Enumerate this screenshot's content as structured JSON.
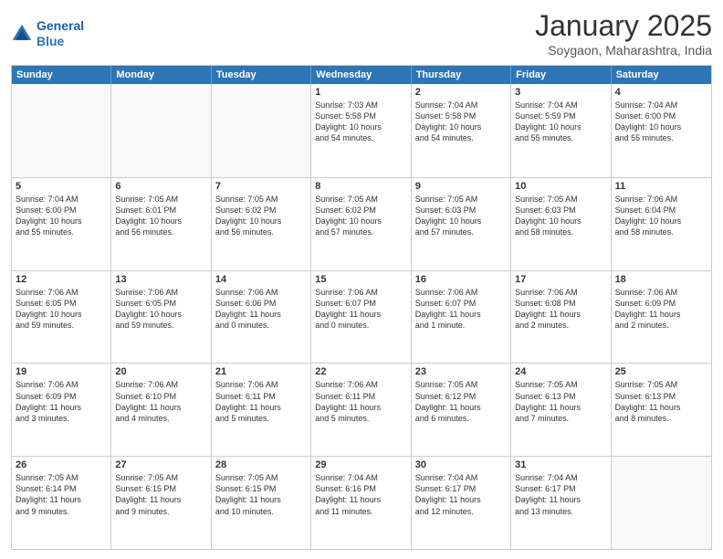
{
  "header": {
    "logo_line1": "General",
    "logo_line2": "Blue",
    "month": "January 2025",
    "location": "Soygaon, Maharashtra, India"
  },
  "weekdays": [
    "Sunday",
    "Monday",
    "Tuesday",
    "Wednesday",
    "Thursday",
    "Friday",
    "Saturday"
  ],
  "weeks": [
    [
      {
        "day": "",
        "info": ""
      },
      {
        "day": "",
        "info": ""
      },
      {
        "day": "",
        "info": ""
      },
      {
        "day": "1",
        "info": "Sunrise: 7:03 AM\nSunset: 5:58 PM\nDaylight: 10 hours\nand 54 minutes."
      },
      {
        "day": "2",
        "info": "Sunrise: 7:04 AM\nSunset: 5:58 PM\nDaylight: 10 hours\nand 54 minutes."
      },
      {
        "day": "3",
        "info": "Sunrise: 7:04 AM\nSunset: 5:59 PM\nDaylight: 10 hours\nand 55 minutes."
      },
      {
        "day": "4",
        "info": "Sunrise: 7:04 AM\nSunset: 6:00 PM\nDaylight: 10 hours\nand 55 minutes."
      }
    ],
    [
      {
        "day": "5",
        "info": "Sunrise: 7:04 AM\nSunset: 6:00 PM\nDaylight: 10 hours\nand 55 minutes."
      },
      {
        "day": "6",
        "info": "Sunrise: 7:05 AM\nSunset: 6:01 PM\nDaylight: 10 hours\nand 56 minutes."
      },
      {
        "day": "7",
        "info": "Sunrise: 7:05 AM\nSunset: 6:02 PM\nDaylight: 10 hours\nand 56 minutes."
      },
      {
        "day": "8",
        "info": "Sunrise: 7:05 AM\nSunset: 6:02 PM\nDaylight: 10 hours\nand 57 minutes."
      },
      {
        "day": "9",
        "info": "Sunrise: 7:05 AM\nSunset: 6:03 PM\nDaylight: 10 hours\nand 57 minutes."
      },
      {
        "day": "10",
        "info": "Sunrise: 7:05 AM\nSunset: 6:03 PM\nDaylight: 10 hours\nand 58 minutes."
      },
      {
        "day": "11",
        "info": "Sunrise: 7:06 AM\nSunset: 6:04 PM\nDaylight: 10 hours\nand 58 minutes."
      }
    ],
    [
      {
        "day": "12",
        "info": "Sunrise: 7:06 AM\nSunset: 6:05 PM\nDaylight: 10 hours\nand 59 minutes."
      },
      {
        "day": "13",
        "info": "Sunrise: 7:06 AM\nSunset: 6:05 PM\nDaylight: 10 hours\nand 59 minutes."
      },
      {
        "day": "14",
        "info": "Sunrise: 7:06 AM\nSunset: 6:06 PM\nDaylight: 11 hours\nand 0 minutes."
      },
      {
        "day": "15",
        "info": "Sunrise: 7:06 AM\nSunset: 6:07 PM\nDaylight: 11 hours\nand 0 minutes."
      },
      {
        "day": "16",
        "info": "Sunrise: 7:06 AM\nSunset: 6:07 PM\nDaylight: 11 hours\nand 1 minute."
      },
      {
        "day": "17",
        "info": "Sunrise: 7:06 AM\nSunset: 6:08 PM\nDaylight: 11 hours\nand 2 minutes."
      },
      {
        "day": "18",
        "info": "Sunrise: 7:06 AM\nSunset: 6:09 PM\nDaylight: 11 hours\nand 2 minutes."
      }
    ],
    [
      {
        "day": "19",
        "info": "Sunrise: 7:06 AM\nSunset: 6:09 PM\nDaylight: 11 hours\nand 3 minutes."
      },
      {
        "day": "20",
        "info": "Sunrise: 7:06 AM\nSunset: 6:10 PM\nDaylight: 11 hours\nand 4 minutes."
      },
      {
        "day": "21",
        "info": "Sunrise: 7:06 AM\nSunset: 6:11 PM\nDaylight: 11 hours\nand 5 minutes."
      },
      {
        "day": "22",
        "info": "Sunrise: 7:06 AM\nSunset: 6:11 PM\nDaylight: 11 hours\nand 5 minutes."
      },
      {
        "day": "23",
        "info": "Sunrise: 7:05 AM\nSunset: 6:12 PM\nDaylight: 11 hours\nand 6 minutes."
      },
      {
        "day": "24",
        "info": "Sunrise: 7:05 AM\nSunset: 6:13 PM\nDaylight: 11 hours\nand 7 minutes."
      },
      {
        "day": "25",
        "info": "Sunrise: 7:05 AM\nSunset: 6:13 PM\nDaylight: 11 hours\nand 8 minutes."
      }
    ],
    [
      {
        "day": "26",
        "info": "Sunrise: 7:05 AM\nSunset: 6:14 PM\nDaylight: 11 hours\nand 9 minutes."
      },
      {
        "day": "27",
        "info": "Sunrise: 7:05 AM\nSunset: 6:15 PM\nDaylight: 11 hours\nand 9 minutes."
      },
      {
        "day": "28",
        "info": "Sunrise: 7:05 AM\nSunset: 6:15 PM\nDaylight: 11 hours\nand 10 minutes."
      },
      {
        "day": "29",
        "info": "Sunrise: 7:04 AM\nSunset: 6:16 PM\nDaylight: 11 hours\nand 11 minutes."
      },
      {
        "day": "30",
        "info": "Sunrise: 7:04 AM\nSunset: 6:17 PM\nDaylight: 11 hours\nand 12 minutes."
      },
      {
        "day": "31",
        "info": "Sunrise: 7:04 AM\nSunset: 6:17 PM\nDaylight: 11 hours\nand 13 minutes."
      },
      {
        "day": "",
        "info": ""
      }
    ]
  ]
}
